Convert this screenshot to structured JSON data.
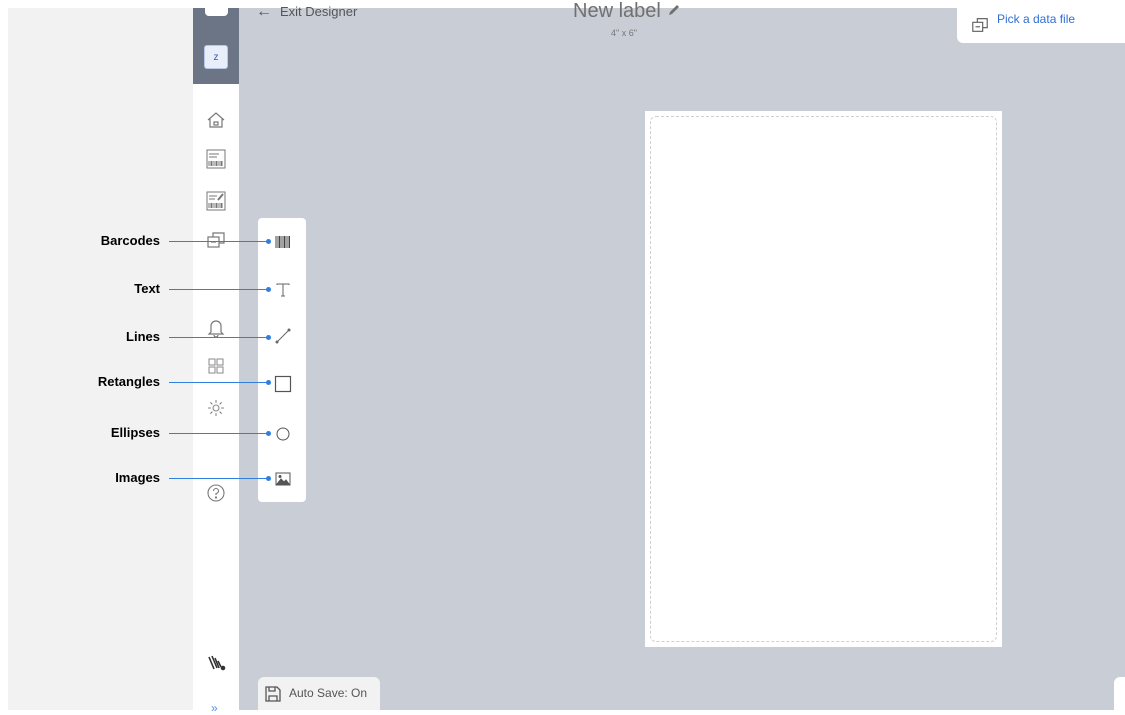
{
  "header": {
    "exit_label": "Exit Designer",
    "label_title": "New label",
    "label_size": "4\" x 6\""
  },
  "data_source": {
    "pick_label": "Pick a data file"
  },
  "sidebar": {
    "avatar_initial": "z",
    "items": [
      {
        "icon": "home-icon"
      },
      {
        "icon": "label-icon"
      },
      {
        "icon": "label-edit-icon"
      },
      {
        "icon": "data-link-icon"
      },
      {
        "icon": "bell-icon"
      },
      {
        "icon": "grid-icon"
      },
      {
        "icon": "gear-icon"
      },
      {
        "icon": "help-icon"
      },
      {
        "icon": "zebra-logo-icon"
      }
    ]
  },
  "toolbox": {
    "tools": [
      {
        "name": "Barcodes",
        "icon": "barcode-icon"
      },
      {
        "name": "Text",
        "icon": "text-icon"
      },
      {
        "name": "Lines",
        "icon": "line-icon"
      },
      {
        "name": "Retangles",
        "icon": "rectangle-icon"
      },
      {
        "name": "Ellipses",
        "icon": "ellipse-icon"
      },
      {
        "name": "Images",
        "icon": "image-icon"
      }
    ]
  },
  "footer": {
    "autosave_label": "Auto Save: On"
  },
  "colors": {
    "accent": "#2f7ee0",
    "canvas": "#c9cdd5",
    "sidebar_header": "#6b7585"
  }
}
